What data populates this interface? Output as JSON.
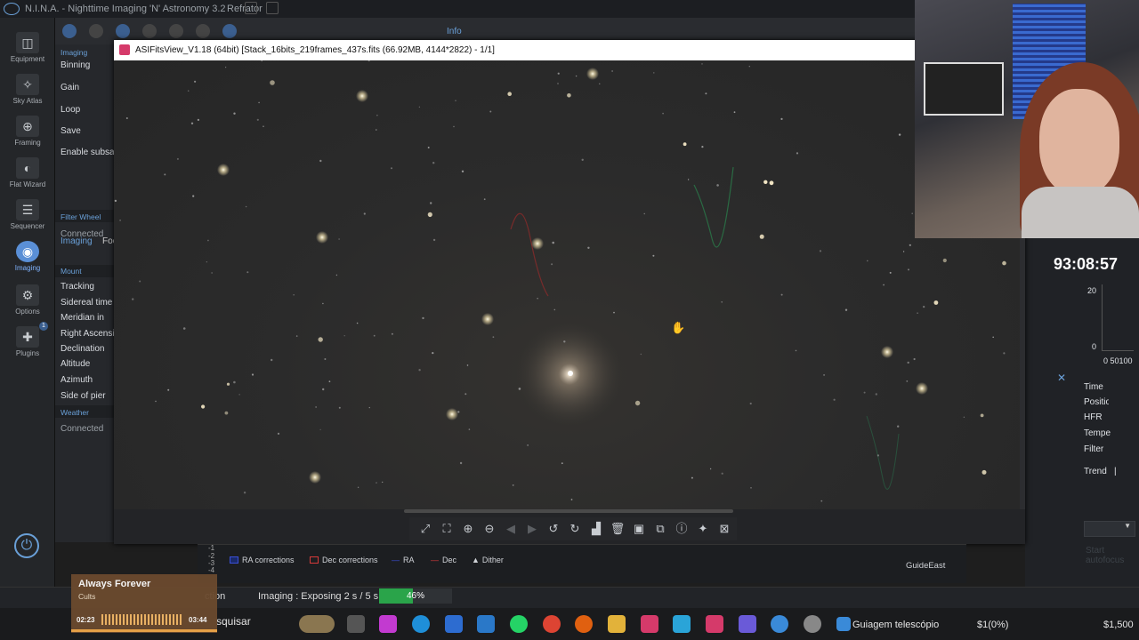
{
  "nina": {
    "title": "N.I.N.A. - Nighttime Imaging 'N' Astronomy 3.2",
    "profile": "Refrator",
    "sidebar": [
      {
        "label": "Equipment",
        "icon": "camera-icon"
      },
      {
        "label": "Sky Atlas",
        "icon": "star-chart-icon"
      },
      {
        "label": "Framing",
        "icon": "framing-icon"
      },
      {
        "label": "Flat Wizard",
        "icon": "flat-wizard-icon"
      },
      {
        "label": "Sequencer",
        "icon": "sequencer-icon"
      },
      {
        "label": "Imaging",
        "icon": "imaging-icon"
      },
      {
        "label": "Options",
        "icon": "gear-icon"
      },
      {
        "label": "Plugins",
        "icon": "puzzle-icon"
      }
    ],
    "plugins_badge": "1",
    "toolbar_info": "Info",
    "panel": {
      "header": "Imaging",
      "items": [
        "Binning",
        "Gain",
        "Loop",
        "Save",
        "Enable subsampling"
      ],
      "tabs": [
        "Imaging",
        "Focuser"
      ],
      "filter_wheel_section": "Filter Wheel",
      "filter_wheel_status": "Connected",
      "mount_section": "Mount",
      "mount_items": [
        "Tracking",
        "Sidereal time",
        "Meridian in",
        "Right Ascension",
        "Declination",
        "Altitude",
        "Azimuth",
        "Side of pier"
      ],
      "weather_section": "Weather",
      "weather_status": "Connected"
    },
    "right": {
      "timer": "93:08:57",
      "axis_20": "20",
      "axis_0": "0",
      "axis_x": "0 50100",
      "fields": [
        "Time",
        "Position",
        "HFR",
        "Temperature",
        "Filter"
      ],
      "trend": "Trend",
      "trend_value": "|",
      "start_auto": "Start autofocus"
    },
    "guide": {
      "y_labels": [
        "-1",
        "-2",
        "-3",
        "-4"
      ],
      "legend": [
        {
          "label": "RA corrections",
          "color": "#3a4fd8"
        },
        {
          "label": "Dec corrections",
          "color": "#d83a3a"
        },
        {
          "label": "RA",
          "color": "#3a4fd8"
        },
        {
          "label": "Dec",
          "color": "#d83a3a"
        },
        {
          "label": "Dither",
          "color": "#dddddd"
        }
      ],
      "direction": "GuideEast"
    },
    "status": {
      "action": "ction",
      "label": "Imaging :  Exposing 2 s / 5 s",
      "progress_pct": "46%",
      "progress_value": 46
    }
  },
  "fitsview": {
    "title": "ASIFitsView_V1.18 (64bit) [Stack_16bits_219frames_437s.fits (66.92MB, 4144*2822) - 1/1]",
    "tools": [
      "fit-1to1-icon",
      "fit-window-icon",
      "zoom-in-icon",
      "zoom-out-icon",
      "prev-icon",
      "next-icon",
      "rotate-left-icon",
      "rotate-right-icon",
      "histogram-icon",
      "delete-icon",
      "save-icon",
      "compare-icon",
      "info-icon",
      "star-icon",
      "stretch-icon"
    ]
  },
  "music": {
    "song": "Always Forever",
    "artist": "Cults",
    "elapsed": "02:23",
    "total": "03:44"
  },
  "taskbar": {
    "search": "squisar",
    "active_label": "Guiagem telescópio",
    "coin": "$1(0%)",
    "price": "$1,500"
  }
}
